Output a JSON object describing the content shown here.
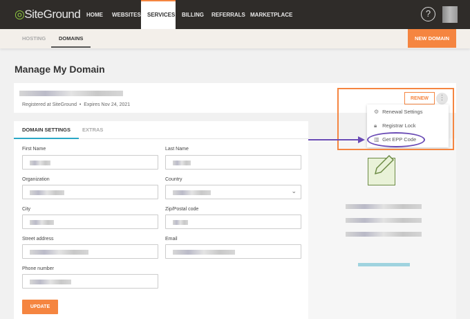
{
  "brand": {
    "name": "SiteGround"
  },
  "nav": {
    "items": [
      "HOME",
      "WEBSITES",
      "SERVICES",
      "BILLING",
      "REFERRALS",
      "MARKETPLACE"
    ],
    "active": "SERVICES",
    "help": "?"
  },
  "subnav": {
    "items": [
      "HOSTING",
      "DOMAINS"
    ],
    "active": "DOMAINS",
    "new_domain": "NEW DOMAIN"
  },
  "page": {
    "title": "Manage My Domain"
  },
  "domain": {
    "registered": "Registered at SiteGround",
    "separator": "•",
    "expires": "Expires Nov 24, 2021",
    "renew": "RENEW",
    "more": "⋮"
  },
  "menu": {
    "items": [
      {
        "icon": "gear-icon",
        "glyph": "⚙",
        "label": "Renewal Settings"
      },
      {
        "icon": "lock-icon",
        "glyph": "🔒︎",
        "label": "Registrar Lock"
      },
      {
        "icon": "barcode-icon",
        "glyph": "▥",
        "label": "Get EPP Code"
      }
    ]
  },
  "tabs": [
    "DOMAIN SETTINGS",
    "EXTRAS"
  ],
  "form": {
    "first_name": "First Name",
    "last_name": "Last Name",
    "organization": "Organization",
    "country": "Country",
    "city": "City",
    "zip": "Zip/Postal code",
    "street": "Street address",
    "email": "Email",
    "phone": "Phone number",
    "update": "UPDATE"
  },
  "colors": {
    "accent": "#f58540",
    "highlight": "#6a4bb5",
    "nav_bg": "#2f2c29"
  }
}
